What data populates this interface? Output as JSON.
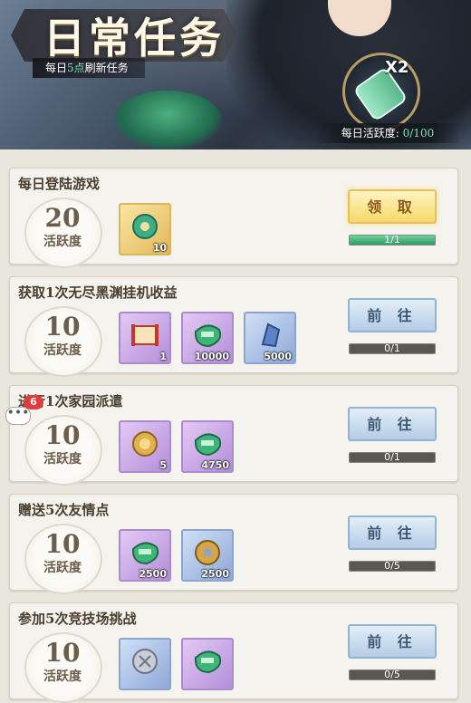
{
  "header": {
    "title": "日常任务",
    "refresh_prefix": "每日",
    "refresh_hour": "5点",
    "refresh_suffix": "刷新任务",
    "multiplier": "X2",
    "activity_label": "每日活跃度: ",
    "activity_value": "0/100"
  },
  "tasks": [
    {
      "title": "每日登陆游戏",
      "points": "20",
      "points_label": "活跃度",
      "button": "领 取",
      "progress": "1/1",
      "progress_fraction": 1.0,
      "rewards": [
        {
          "icon": "jade-token-icon",
          "qty": "10",
          "frame": "gold"
        }
      ]
    },
    {
      "title": "获取1次无尽黑渊挂机收益",
      "points": "10",
      "points_label": "活跃度",
      "button": "前 往",
      "progress": "0/1",
      "progress_fraction": 0,
      "rewards": [
        {
          "icon": "scroll-icon",
          "qty": "1",
          "frame": "purple"
        },
        {
          "icon": "exp-jade-icon",
          "qty": "10000",
          "frame": "purple"
        },
        {
          "icon": "blue-crystal-icon",
          "qty": "5000",
          "frame": "blue"
        }
      ]
    },
    {
      "title": "进行1次家园派遣",
      "points": "10",
      "points_label": "活跃度",
      "button": "前 往",
      "progress": "0/1",
      "progress_fraction": 0,
      "rewards": [
        {
          "icon": "gold-coin-icon",
          "qty": "5",
          "frame": "purple"
        },
        {
          "icon": "exp-jade-icon",
          "qty": "4750",
          "frame": "purple"
        }
      ]
    },
    {
      "title": "赠送5次友情点",
      "points": "10",
      "points_label": "活跃度",
      "button": "前 往",
      "progress": "0/5",
      "progress_fraction": 0,
      "rewards": [
        {
          "icon": "exp-jade-icon",
          "qty": "2500",
          "frame": "purple"
        },
        {
          "icon": "copper-coin-icon",
          "qty": "2500",
          "frame": "blue"
        }
      ]
    },
    {
      "title": "参加5次竞技场挑战",
      "points": "10",
      "points_label": "活跃度",
      "button": "前 往",
      "progress": "0/5",
      "progress_fraction": 0,
      "rewards": [
        {
          "icon": "silver-coin-icon",
          "qty": "",
          "frame": "blue"
        },
        {
          "icon": "exp-jade-icon",
          "qty": "",
          "frame": "purple"
        }
      ]
    }
  ],
  "chat": {
    "badge": "6",
    "bubble": "•••"
  },
  "colors": {
    "accent_green": "#7fe0b4",
    "claim_gold": "#f5d96a",
    "go_blue": "#b5cde6"
  }
}
